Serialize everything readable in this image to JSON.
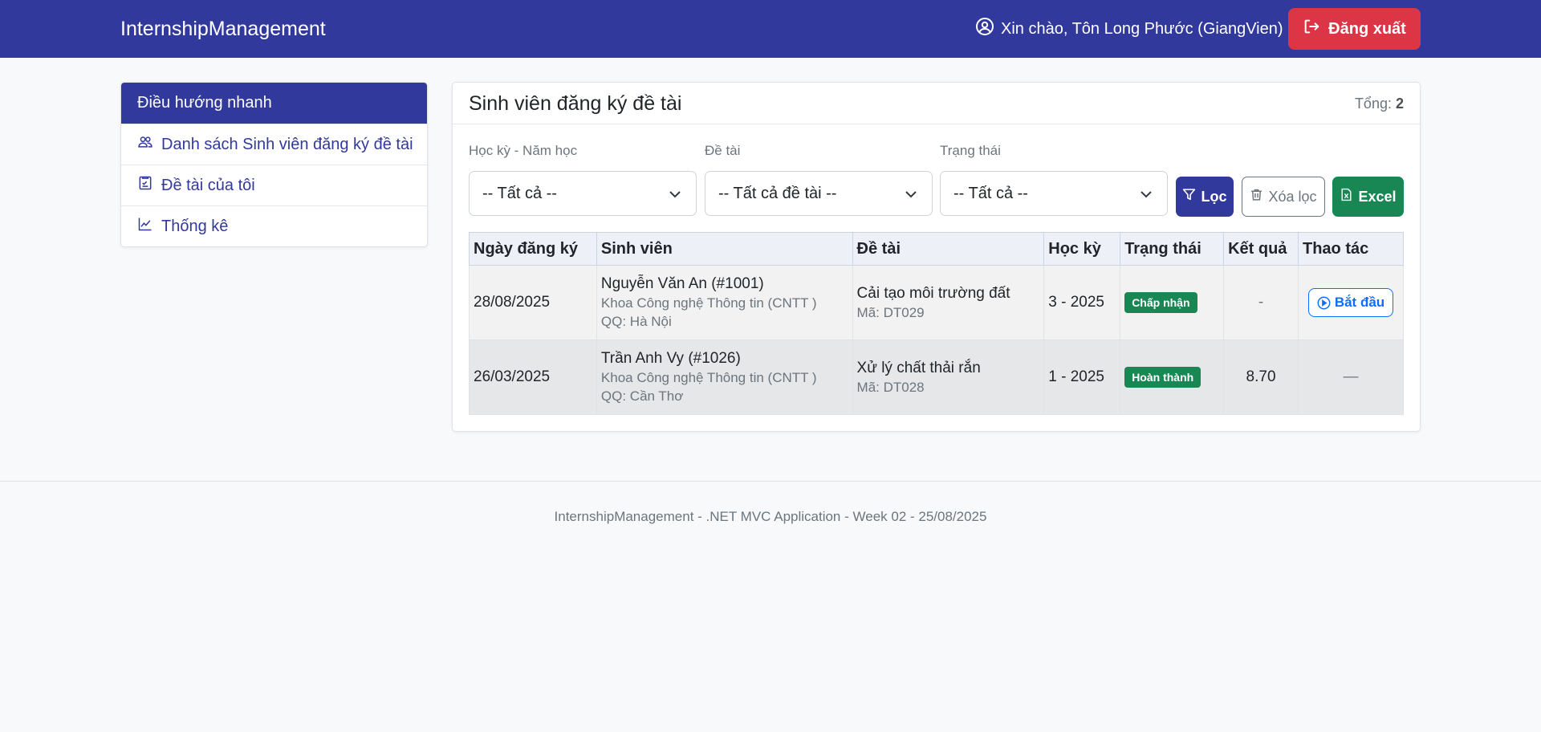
{
  "app": {
    "brand": "InternshipManagement"
  },
  "header": {
    "greeting": "Xin chào, Tôn Long Phước (GiangVien)",
    "logout_label": "Đăng xuất"
  },
  "sidebar": {
    "title": "Điều hướng nhanh",
    "items": [
      {
        "label": "Danh sách Sinh viên đăng ký đề tài",
        "icon": "users-icon"
      },
      {
        "label": "Đề tài của tôi",
        "icon": "checklist-icon"
      },
      {
        "label": "Thống kê",
        "icon": "chart-line-icon"
      }
    ]
  },
  "main": {
    "title": "Sinh viên đăng ký đề tài",
    "total_label": "Tổng:",
    "total_value": "2",
    "filters": [
      {
        "label": "Học kỳ - Năm học",
        "value": "-- Tất cả --"
      },
      {
        "label": "Đề tài",
        "value": "-- Tất cả đề tài --"
      },
      {
        "label": "Trạng thái",
        "value": "-- Tất cả --"
      }
    ],
    "buttons": {
      "filter": "Lọc",
      "clear": "Xóa lọc",
      "excel": "Excel"
    },
    "table": {
      "headers": [
        "Ngày đăng ký",
        "Sinh viên",
        "Đề tài",
        "Học kỳ",
        "Trạng thái",
        "Kết quả",
        "Thao tác"
      ],
      "rows": [
        {
          "date": "28/08/2025",
          "student": "Nguyễn Văn An (#1001)",
          "faculty": "Khoa Công nghệ Thông tin (CNTT )",
          "hometown": "QQ: Hà Nội",
          "topic": "Cải tạo môi trường đất",
          "code": "Mã: DT029",
          "term": "3 - 2025",
          "status": "Chấp nhận",
          "status_color": "#198754",
          "result": "-",
          "action": "Bắt đầu"
        },
        {
          "date": "26/03/2025",
          "student": "Trần Anh Vy (#1026)",
          "faculty": "Khoa Công nghệ Thông tin (CNTT )",
          "hometown": "QQ: Cần Thơ",
          "topic": "Xử lý chất thải rắn",
          "code": "Mã: DT028",
          "term": "1 - 2025",
          "status": "Hoàn thành",
          "status_color": "#198754",
          "result": "8.70",
          "action": "—"
        }
      ]
    }
  },
  "footer": {
    "text": "InternshipManagement - .NET MVC Application - Week 02 - 25/08/2025"
  },
  "colors": {
    "primary": "#32399c",
    "danger": "#dc3545",
    "success": "#198754",
    "link": "#0d6efd"
  }
}
